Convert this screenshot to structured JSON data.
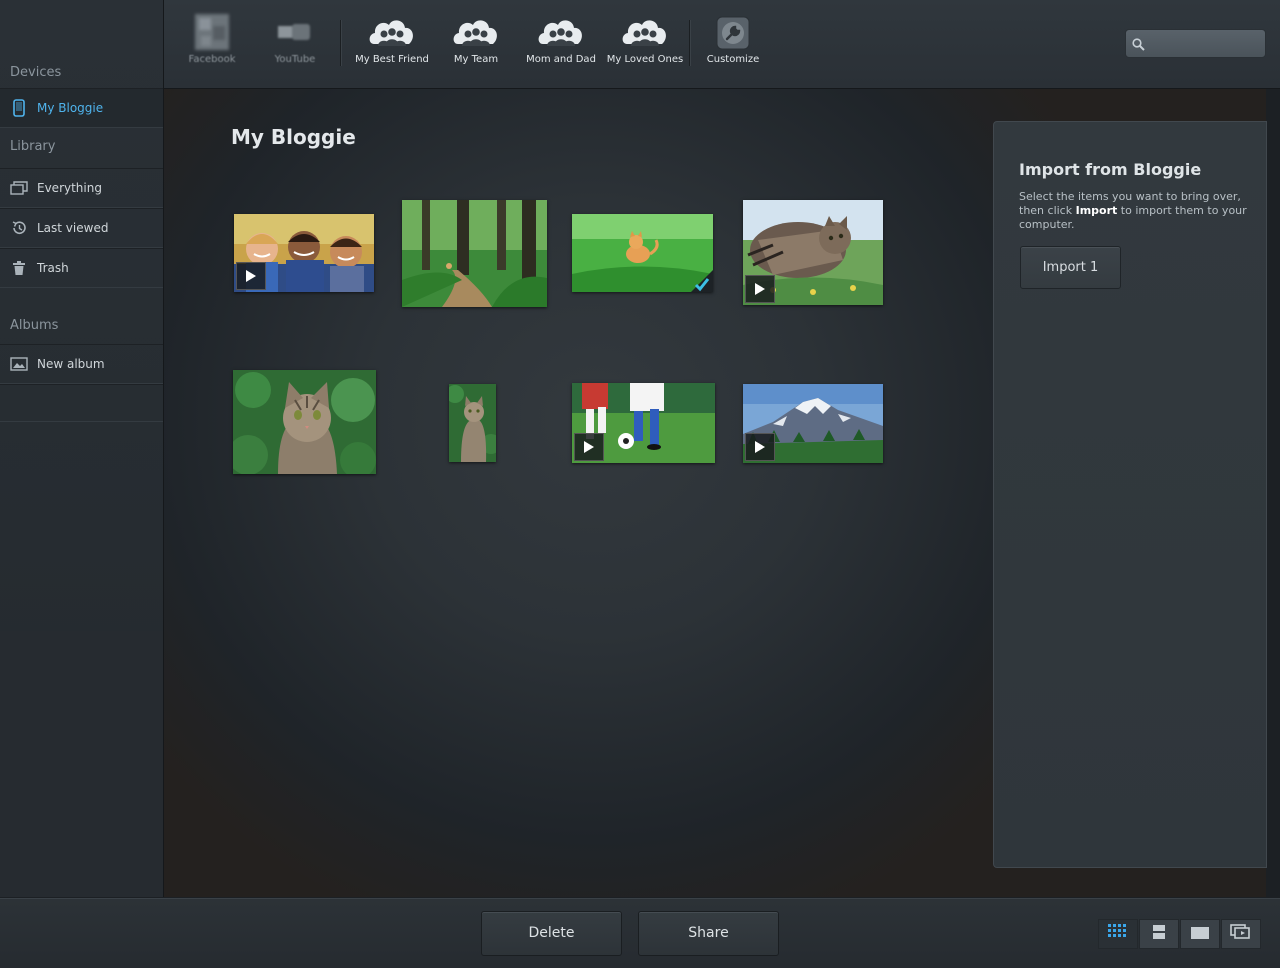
{
  "toolbar": {
    "items": [
      {
        "label": "Facebook",
        "icon": "facebook-icon"
      },
      {
        "label": "YouTube",
        "icon": "youtube-icon"
      },
      {
        "label": "My Best Friend",
        "icon": "group-icon"
      },
      {
        "label": "My Team",
        "icon": "group-icon"
      },
      {
        "label": "Mom and Dad",
        "icon": "group-icon"
      },
      {
        "label": "My Loved Ones",
        "icon": "group-icon"
      },
      {
        "label": "Customize",
        "icon": "wrench-icon"
      }
    ],
    "search": {
      "placeholder": "",
      "value": ""
    }
  },
  "sidebar": {
    "devices_label": "Devices",
    "devices": [
      {
        "label": "My Bloggie",
        "icon": "camera-device-icon",
        "active": true
      }
    ],
    "library_label": "Library",
    "library": [
      {
        "label": "Everything",
        "icon": "stack-icon"
      },
      {
        "label": "Last viewed",
        "icon": "history-icon"
      },
      {
        "label": "Trash",
        "icon": "trash-icon"
      }
    ],
    "albums_label": "Albums",
    "albums": [
      {
        "label": "New album",
        "icon": "album-icon"
      }
    ]
  },
  "main": {
    "title": "My Bloggie",
    "items": [
      {
        "subject": "three smiling children",
        "video": true,
        "selected": false
      },
      {
        "subject": "cat on forest path",
        "video": false,
        "selected": false
      },
      {
        "subject": "kitten in green grass",
        "video": false,
        "selected": true
      },
      {
        "subject": "tabby cat in flowers",
        "video": true,
        "selected": false
      },
      {
        "subject": "tabby cat portrait",
        "video": false,
        "selected": false
      },
      {
        "subject": "tabby cat sitting",
        "video": false,
        "selected": false
      },
      {
        "subject": "soccer players kicking ball",
        "video": true,
        "selected": false
      },
      {
        "subject": "snowy mountain landscape",
        "video": true,
        "selected": false
      }
    ]
  },
  "import_panel": {
    "title": "Import from Bloggie",
    "desc_before": "Select the items you want to bring over, then click ",
    "desc_bold": "Import",
    "desc_after": " to import them to your computer.",
    "button_label": "Import 1"
  },
  "bottom": {
    "delete_label": "Delete",
    "share_label": "Share",
    "view_modes": [
      "grid-view-icon",
      "single-view-icon",
      "fullscreen-view-icon",
      "slideshow-view-icon"
    ],
    "active_view": "grid-view-icon"
  },
  "colors": {
    "accent": "#4fb3ec",
    "selected_check": "#3cc0e6"
  }
}
